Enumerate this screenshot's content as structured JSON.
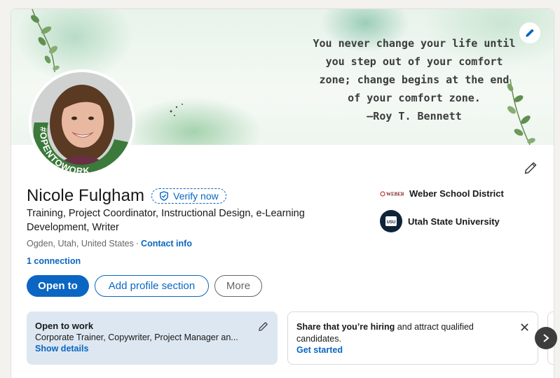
{
  "banner": {
    "quote_lines": [
      "You never change your life until",
      "you step out of your comfort",
      "zone; change begins at the end",
      "of your comfort zone.",
      "—Roy T. Bennett"
    ],
    "edit_icon": "pencil-icon"
  },
  "profile": {
    "name": "Nicole Fulgham",
    "verify_label": "Verify now",
    "headline": "Training, Project Coordinator, Instructional Design, e-Learning Development, Writer",
    "location": "Ogden, Utah, United States",
    "separator": "·",
    "contact_label": "Contact info",
    "connections": "1 connection",
    "avatar_badge": "#OPENTOWORK"
  },
  "actions": {
    "open_to": "Open to",
    "add_section": "Add profile section",
    "more": "More"
  },
  "experience": [
    {
      "name": "Weber School District",
      "logo_text": "WEBER"
    },
    {
      "name": "Utah State University",
      "logo_text": "USU"
    }
  ],
  "open_to_work": {
    "title": "Open to work",
    "roles": "Corporate Trainer, Copywriter, Project Manager an...",
    "link": "Show details"
  },
  "hiring": {
    "bold": "Share that you’re hiring",
    "rest": " and attract qualified candidates.",
    "link": "Get started"
  },
  "colors": {
    "brand_blue": "#0a66c2",
    "open_to_work_bg": "#dde7f1",
    "badge_green": "#3b7a3a"
  }
}
